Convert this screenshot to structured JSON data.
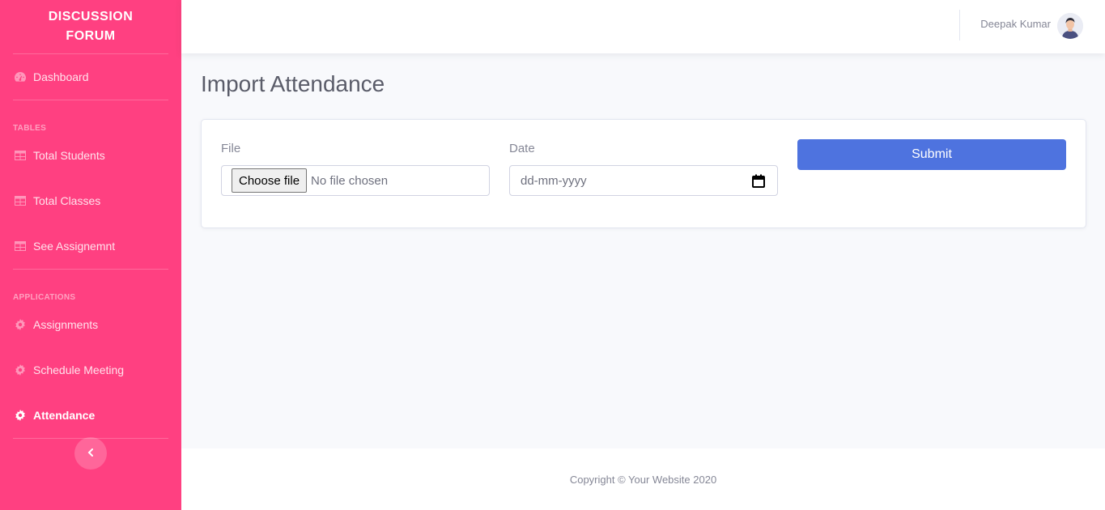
{
  "sidebar": {
    "brand": "DISCUSSION FORUM",
    "dashboard": {
      "label": "Dashboard",
      "icon": "tachometer-icon"
    },
    "tables_heading": "TABLES",
    "tables_items": [
      {
        "label": "Total Students",
        "icon": "table-icon"
      },
      {
        "label": "Total Classes",
        "icon": "table-icon"
      },
      {
        "label": "See Assignemnt",
        "icon": "table-icon"
      }
    ],
    "applications_heading": "APPLICATIONS",
    "applications_items": [
      {
        "label": "Assignments",
        "icon": "cog-icon"
      },
      {
        "label": "Schedule Meeting",
        "icon": "cog-icon"
      },
      {
        "label": "Attendance",
        "icon": "cog-icon",
        "active": true
      }
    ],
    "toggle_icon": "chevron-left-icon",
    "color": "#ff4081"
  },
  "topbar": {
    "user_name": "Deepak Kumar",
    "avatar_icon": "user-avatar"
  },
  "main": {
    "title": "Import Attendance",
    "form": {
      "file_label": "File",
      "file_button": "Choose file",
      "file_status": "No file chosen",
      "date_label": "Date",
      "date_placeholder": "dd-mm-yyyy",
      "submit_label": "Submit",
      "submit_color": "#4e73df"
    }
  },
  "footer": {
    "copyright": "Copyright © Your Website 2020"
  }
}
